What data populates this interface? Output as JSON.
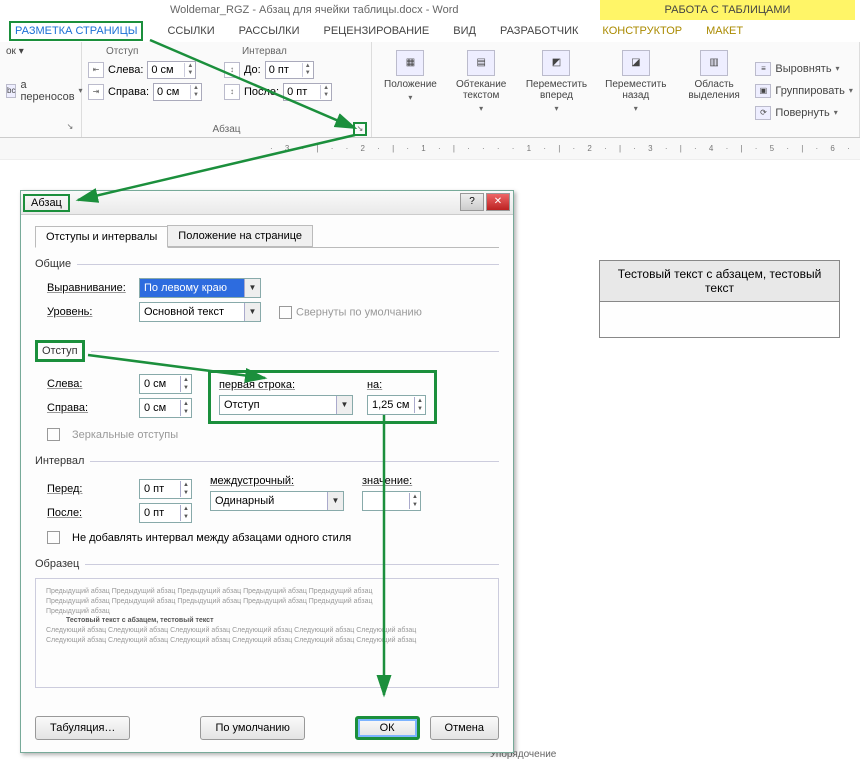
{
  "title": "Woldemar_RGZ - Абзац для ячейки таблицы.docx - Word",
  "context_tab": "РАБОТА С ТАБЛИЦАМИ",
  "tabs": {
    "layout": "РАЗМЕТКА СТРАНИЦЫ",
    "links": "ССЫЛКИ",
    "mailings": "РАССЫЛКИ",
    "review": "РЕЦЕНЗИРОВАНИЕ",
    "view": "ВИД",
    "developer": "РАЗРАБОТЧИК",
    "design": "КОНСТРУКТОР",
    "tlayout": "МАКЕТ"
  },
  "ribbon": {
    "hyphen": "а переносов",
    "para": {
      "indent_label": "Отступ",
      "interval_label": "Интервал",
      "left": "Слева:",
      "left_v": "0 см",
      "right": "Справа:",
      "right_v": "0 см",
      "before": "До:",
      "before_v": "0 пт",
      "after": "После:",
      "after_v": "0 пт",
      "group_label": "Абзац"
    },
    "arrange": {
      "position": "Положение",
      "wrap": "Обтекание текстом",
      "forward": "Переместить вперед",
      "backward": "Переместить назад",
      "selection_pane": "Область выделения",
      "align": "Выровнять",
      "group": "Группировать",
      "rotate": "Повернуть",
      "group_label": "Упорядочение"
    }
  },
  "doc_cell": "Тестовый текст с абзацем, тестовый текст",
  "dialog": {
    "title": "Абзац",
    "tab1": "Отступы и интервалы",
    "tab2": "Положение на странице",
    "sec_general": "Общие",
    "align_label": "Выравнивание:",
    "align_value": "По левому краю",
    "level_label": "Уровень:",
    "level_value": "Основной текст",
    "collapsed": "Свернуты по умолчанию",
    "sec_indent": "Отступ",
    "left_label": "Слева:",
    "left_v": "0 см",
    "right_label": "Справа:",
    "right_v": "0 см",
    "first_label": "первая строка:",
    "first_value": "Отступ",
    "by_label": "на:",
    "by_value": "1,25 см",
    "mirror": "Зеркальные отступы",
    "sec_interval": "Интервал",
    "before_label": "Перед:",
    "before_v": "0 пт",
    "after_label": "После:",
    "after_v": "0 пт",
    "lines_label": "междустрочный:",
    "lines_value": "Одинарный",
    "val_label": "значение:",
    "noadd": "Не добавлять интервал между абзацами одного стиля",
    "sec_sample": "Образец",
    "sample_prev": "Предыдущий абзац Предыдущий абзац Предыдущий абзац Предыдущий абзац Предыдущий абзац",
    "sample_bold": "Тестовый текст с абзацем, тестовый текст",
    "sample_next": "Следующий абзац Следующий абзац Следующий абзац Следующий абзац Следующий абзац Следующий абзац",
    "btn_tabs": "Табуляция…",
    "btn_default": "По умолчанию",
    "btn_ok": "ОК",
    "btn_cancel": "Отмена"
  }
}
